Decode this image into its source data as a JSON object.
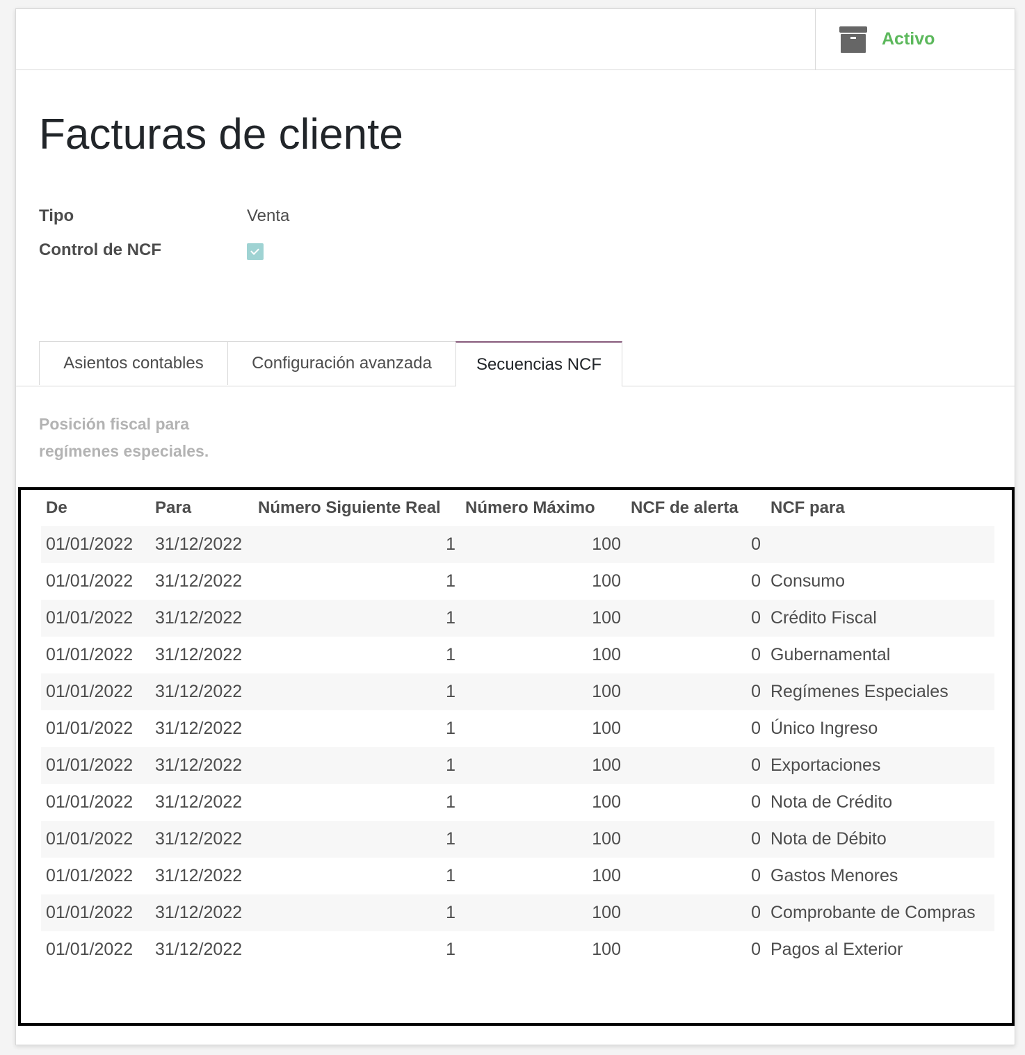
{
  "status_button": {
    "icon": "archive-icon",
    "label": "Activo",
    "color": "#5cb85c"
  },
  "title": "Facturas de cliente",
  "fields": {
    "tipo": {
      "label": "Tipo",
      "value": "Venta"
    },
    "control_ncf": {
      "label": "Control de NCF",
      "checked": true
    }
  },
  "tabs": [
    {
      "label": "Asientos contables",
      "active": false
    },
    {
      "label": "Configuración avanzada",
      "active": false
    },
    {
      "label": "Secuencias NCF",
      "active": true
    }
  ],
  "help_text": "Posición fiscal para regímenes especiales.",
  "table": {
    "columns": [
      "De",
      "Para",
      "Número Siguiente Real",
      "Número Máximo",
      "NCF de alerta",
      "NCF para"
    ],
    "rows": [
      [
        "01/01/2022",
        "31/12/2022",
        "1",
        "100",
        "0",
        ""
      ],
      [
        "01/01/2022",
        "31/12/2022",
        "1",
        "100",
        "0",
        "Consumo"
      ],
      [
        "01/01/2022",
        "31/12/2022",
        "1",
        "100",
        "0",
        "Crédito Fiscal"
      ],
      [
        "01/01/2022",
        "31/12/2022",
        "1",
        "100",
        "0",
        "Gubernamental"
      ],
      [
        "01/01/2022",
        "31/12/2022",
        "1",
        "100",
        "0",
        "Regímenes Especiales"
      ],
      [
        "01/01/2022",
        "31/12/2022",
        "1",
        "100",
        "0",
        "Único Ingreso"
      ],
      [
        "01/01/2022",
        "31/12/2022",
        "1",
        "100",
        "0",
        "Exportaciones"
      ],
      [
        "01/01/2022",
        "31/12/2022",
        "1",
        "100",
        "0",
        "Nota de Crédito"
      ],
      [
        "01/01/2022",
        "31/12/2022",
        "1",
        "100",
        "0",
        "Nota de Débito"
      ],
      [
        "01/01/2022",
        "31/12/2022",
        "1",
        "100",
        "0",
        "Gastos Menores"
      ],
      [
        "01/01/2022",
        "31/12/2022",
        "1",
        "100",
        "0",
        "Comprobante de Compras"
      ],
      [
        "01/01/2022",
        "31/12/2022",
        "1",
        "100",
        "0",
        "Pagos al Exterior"
      ]
    ]
  }
}
